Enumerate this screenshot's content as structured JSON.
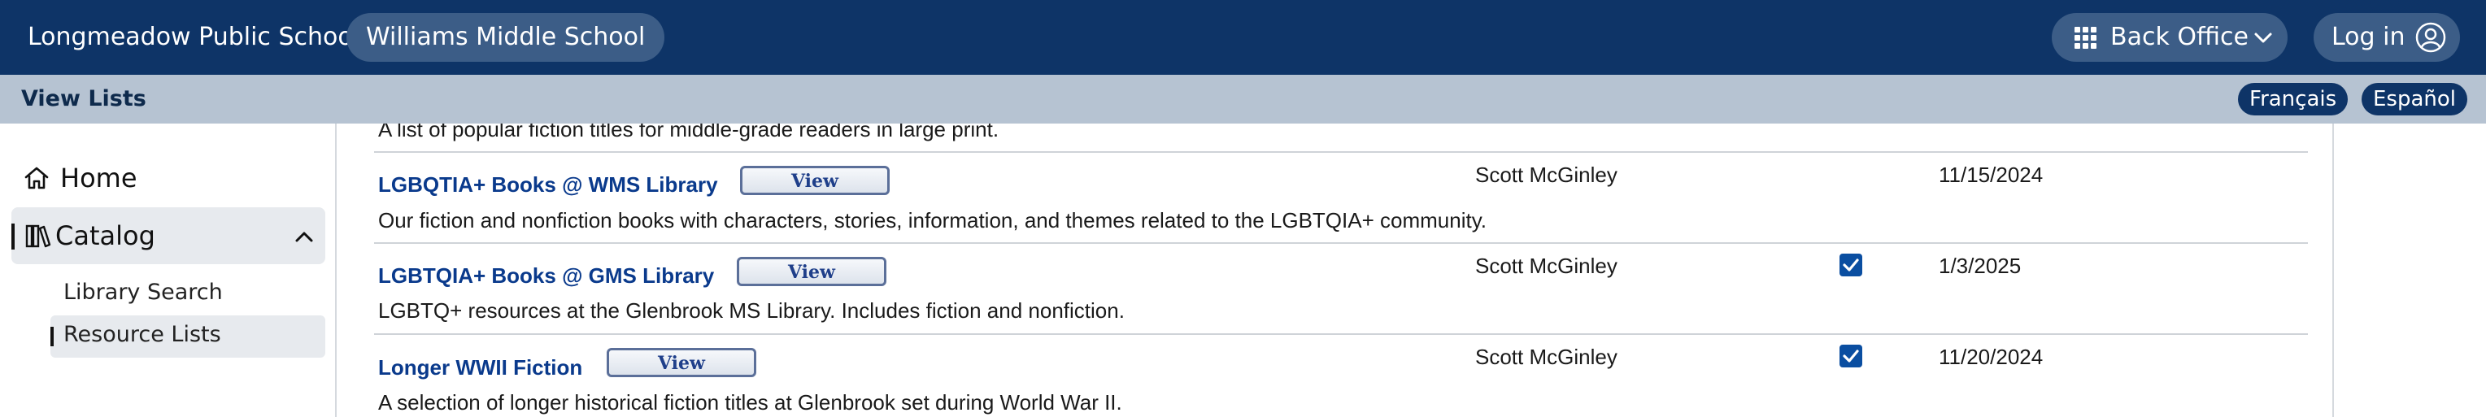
{
  "header": {
    "district": "Longmeadow Public Schools",
    "school": "Williams Middle School",
    "back_office": "Back Office",
    "login": "Log in"
  },
  "subbar": {
    "title": "View Lists",
    "languages": [
      "Français",
      "Español"
    ]
  },
  "sidebar": {
    "home": "Home",
    "catalog": "Catalog",
    "sub_items": [
      "Library Search",
      "Resource Lists"
    ]
  },
  "lists": {
    "partial_description": "A list of popular fiction titles for middle-grade readers in large print.",
    "view_label": "View",
    "rows": [
      {
        "title": "LGBQTIA+ Books @ WMS Library",
        "description": "Our fiction and nonfiction books with characters, stories, information, and themes related to the LGBTQIA+ community.",
        "owner": "Scott McGinley",
        "public": false,
        "date": "11/15/2024"
      },
      {
        "title": "LGBTQIA+ Books @ GMS Library",
        "description": "LGBTQ+ resources at the Glenbrook MS Library. Includes fiction and nonfiction.",
        "owner": "Scott McGinley",
        "public": true,
        "date": "1/3/2025"
      },
      {
        "title": "Longer WWII Fiction",
        "description": "A selection of longer historical fiction titles at Glenbrook set during World War II.",
        "owner": "Scott McGinley",
        "public": true,
        "date": "11/20/2024"
      }
    ]
  },
  "colors": {
    "header_bg": "#0e3467",
    "pill_bg": "#3c5d87",
    "subbar_bg": "#b6c3d2",
    "link": "#0a3a8c",
    "checkbox": "#0a4ea1"
  }
}
